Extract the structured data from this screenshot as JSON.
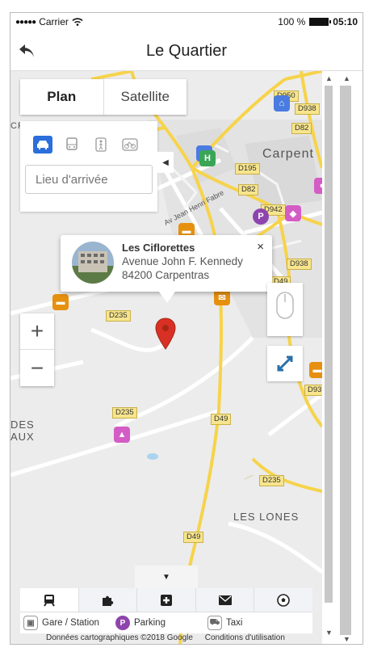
{
  "status_bar": {
    "carrier": "Carrier",
    "battery": "100 %",
    "time": "05:10"
  },
  "header": {
    "title": "Le Quartier",
    "back_icon": "back-arrow-icon"
  },
  "map_type": {
    "plan": "Plan",
    "satellite": "Satellite",
    "selected": "Plan"
  },
  "directions": {
    "modes": [
      "car-icon",
      "bus-icon",
      "pedestrian-icon",
      "bicycle-icon"
    ],
    "selected_mode": "car-icon",
    "destination_placeholder": "Lieu d'arrivée"
  },
  "map_labels": {
    "roads": [
      "D950",
      "D938",
      "D82",
      "D195",
      "D82",
      "D942",
      "D938",
      "D49",
      "D235",
      "D235",
      "D49",
      "D235",
      "D49",
      "D93"
    ],
    "street": "Av Jean Henri Fabre",
    "places": [
      "CROSETTE",
      "Carpent",
      "DES",
      "AUX",
      "LES LONES"
    ]
  },
  "info_window": {
    "name": "Les Ciflorettes",
    "address_line1": "Avenue John F. Kennedy",
    "address_line2": "84200 Carpentras",
    "close": "×"
  },
  "zoom": {
    "in": "+",
    "out": "−"
  },
  "bottom_tabs": [
    "train-icon",
    "puzzle-icon",
    "health-icon",
    "mail-icon",
    "soccer-icon"
  ],
  "legend": [
    {
      "label": "Gare / Station",
      "icon": "train-icon"
    },
    {
      "label": "Parking",
      "icon": "parking-icon",
      "letter": "P"
    },
    {
      "label": "Taxi",
      "icon": "taxi-icon"
    }
  ],
  "attribution": {
    "data": "Données cartographiques ©2018 Google",
    "terms": "Conditions d'utilisation"
  },
  "colors": {
    "accent_blue": "#2a6fdb",
    "marker_red": "#d93025",
    "poi_purple": "#8e44ad",
    "poi_orange": "#e6900f",
    "road_yellow": "#f6d34a"
  }
}
